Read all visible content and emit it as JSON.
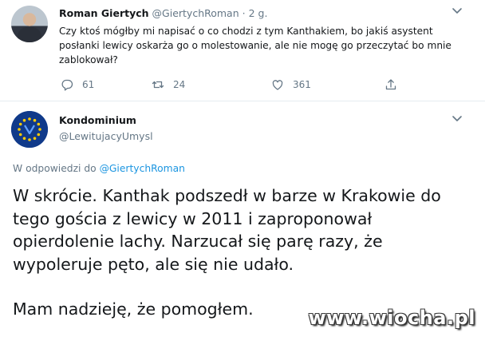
{
  "tweet1": {
    "author_name": "Roman Giertych",
    "handle": "@GiertychRoman",
    "separator": "·",
    "time": "2 g.",
    "text": "Czy ktoś mógłby mi napisać o co chodzi z tym Kanthakiem, bo jakiś asystent posłanki lewicy oskarża go o molestowanie, ale nie mogę go przeczytać bo mnie zablokował?",
    "replies": "61",
    "retweets": "24",
    "likes": "361"
  },
  "tweet2": {
    "author_name": "Kondominium",
    "handle": "@LewitujacyUmysl",
    "reply_prefix": "W odpowiedzi do",
    "reply_to": "@GiertychRoman",
    "paragraph1": "W skrócie. Kanthak podszedł w barze w Krakowie do tego gościa z lewicy w 2011 i zaproponował opierdolenie lachy. Narzucał się parę razy, że wypoleruje pęto, ale się nie udało.",
    "paragraph2": "Mam nadzieję, że pomogłem."
  },
  "watermark": "www.wiocha.pl",
  "icons": {
    "reply": "reply-icon",
    "retweet": "retweet-icon",
    "like": "heart-icon",
    "share": "share-icon",
    "menu": "chevron-down-icon"
  },
  "colors": {
    "link": "#1b95e0",
    "muted": "#657786",
    "text": "#14171a",
    "eu_blue": "#103a8a",
    "eu_star": "#ffcc00"
  }
}
